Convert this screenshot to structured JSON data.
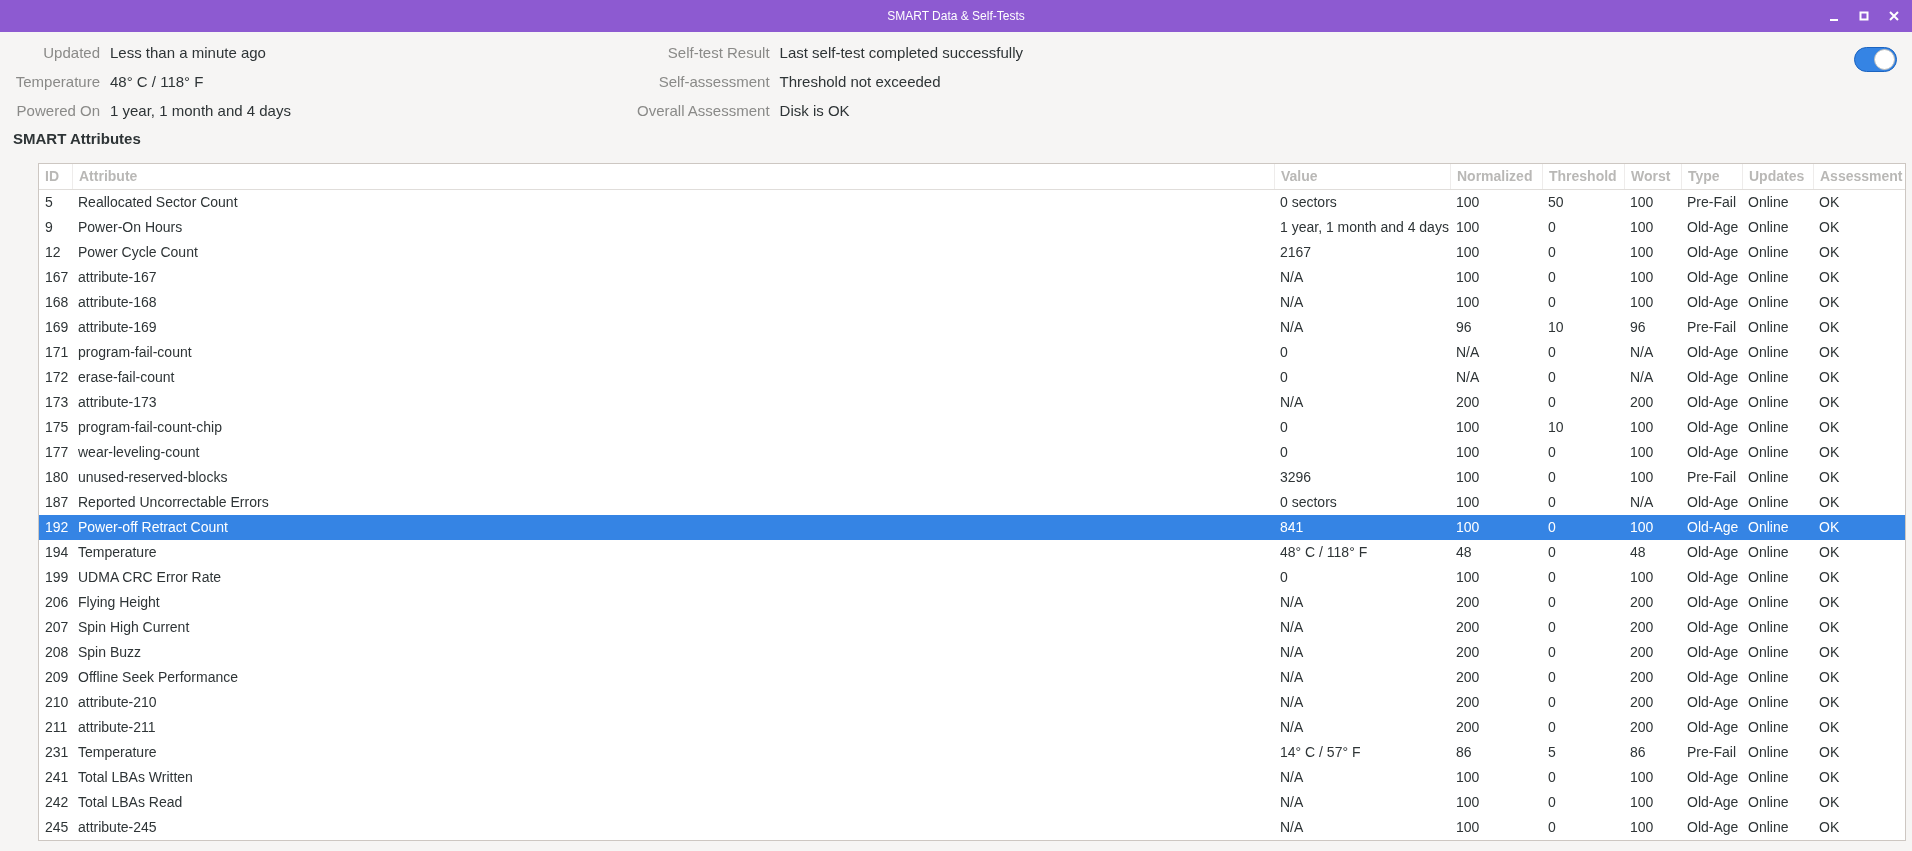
{
  "window": {
    "title": "SMART Data & Self-Tests"
  },
  "info_left": [
    {
      "label": "Updated",
      "value": "Less than a minute ago"
    },
    {
      "label": "Temperature",
      "value": "48° C / 118° F"
    },
    {
      "label": "Powered On",
      "value": "1 year, 1 month and 4 days"
    }
  ],
  "info_right": [
    {
      "label": "Self-test Result",
      "value": "Last self-test completed successfully"
    },
    {
      "label": "Self-assessment",
      "value": "Threshold not exceeded"
    },
    {
      "label": "Overall Assessment",
      "value": "Disk is OK"
    }
  ],
  "toggle": {
    "on": true
  },
  "section_title": "SMART Attributes",
  "table": {
    "columns": [
      "ID",
      "Attribute",
      "Value",
      "Normalized",
      "Threshold",
      "Worst",
      "Type",
      "Updates",
      "Assessment"
    ],
    "rows": [
      {
        "cells": [
          "5",
          "Reallocated Sector Count",
          "0 sectors",
          "100",
          "50",
          "100",
          "Pre-Fail",
          "Online",
          "OK"
        ],
        "selected": false
      },
      {
        "cells": [
          "9",
          "Power-On Hours",
          "1 year, 1 month and 4 days",
          "100",
          "0",
          "100",
          "Old-Age",
          "Online",
          "OK"
        ],
        "selected": false
      },
      {
        "cells": [
          "12",
          "Power Cycle Count",
          "2167",
          "100",
          "0",
          "100",
          "Old-Age",
          "Online",
          "OK"
        ],
        "selected": false
      },
      {
        "cells": [
          "167",
          "attribute-167",
          "N/A",
          "100",
          "0",
          "100",
          "Old-Age",
          "Online",
          "OK"
        ],
        "selected": false
      },
      {
        "cells": [
          "168",
          "attribute-168",
          "N/A",
          "100",
          "0",
          "100",
          "Old-Age",
          "Online",
          "OK"
        ],
        "selected": false
      },
      {
        "cells": [
          "169",
          "attribute-169",
          "N/A",
          "96",
          "10",
          "96",
          "Pre-Fail",
          "Online",
          "OK"
        ],
        "selected": false
      },
      {
        "cells": [
          "171",
          "program-fail-count",
          "0",
          "N/A",
          "0",
          "N/A",
          "Old-Age",
          "Online",
          "OK"
        ],
        "selected": false
      },
      {
        "cells": [
          "172",
          "erase-fail-count",
          "0",
          "N/A",
          "0",
          "N/A",
          "Old-Age",
          "Online",
          "OK"
        ],
        "selected": false
      },
      {
        "cells": [
          "173",
          "attribute-173",
          "N/A",
          "200",
          "0",
          "200",
          "Old-Age",
          "Online",
          "OK"
        ],
        "selected": false
      },
      {
        "cells": [
          "175",
          "program-fail-count-chip",
          "0",
          "100",
          "10",
          "100",
          "Old-Age",
          "Online",
          "OK"
        ],
        "selected": false
      },
      {
        "cells": [
          "177",
          "wear-leveling-count",
          "0",
          "100",
          "0",
          "100",
          "Old-Age",
          "Online",
          "OK"
        ],
        "selected": false
      },
      {
        "cells": [
          "180",
          "unused-reserved-blocks",
          "3296",
          "100",
          "0",
          "100",
          "Pre-Fail",
          "Online",
          "OK"
        ],
        "selected": false
      },
      {
        "cells": [
          "187",
          "Reported Uncorrectable Errors",
          "0 sectors",
          "100",
          "0",
          "N/A",
          "Old-Age",
          "Online",
          "OK"
        ],
        "selected": false
      },
      {
        "cells": [
          "192",
          "Power-off Retract Count",
          "841",
          "100",
          "0",
          "100",
          "Old-Age",
          "Online",
          "OK"
        ],
        "selected": true
      },
      {
        "cells": [
          "194",
          "Temperature",
          "48° C / 118° F",
          "48",
          "0",
          "48",
          "Old-Age",
          "Online",
          "OK"
        ],
        "selected": false
      },
      {
        "cells": [
          "199",
          "UDMA CRC Error Rate",
          "0",
          "100",
          "0",
          "100",
          "Old-Age",
          "Online",
          "OK"
        ],
        "selected": false
      },
      {
        "cells": [
          "206",
          "Flying Height",
          "N/A",
          "200",
          "0",
          "200",
          "Old-Age",
          "Online",
          "OK"
        ],
        "selected": false
      },
      {
        "cells": [
          "207",
          "Spin High Current",
          "N/A",
          "200",
          "0",
          "200",
          "Old-Age",
          "Online",
          "OK"
        ],
        "selected": false
      },
      {
        "cells": [
          "208",
          "Spin Buzz",
          "N/A",
          "200",
          "0",
          "200",
          "Old-Age",
          "Online",
          "OK"
        ],
        "selected": false
      },
      {
        "cells": [
          "209",
          "Offline Seek Performance",
          "N/A",
          "200",
          "0",
          "200",
          "Old-Age",
          "Online",
          "OK"
        ],
        "selected": false
      },
      {
        "cells": [
          "210",
          "attribute-210",
          "N/A",
          "200",
          "0",
          "200",
          "Old-Age",
          "Online",
          "OK"
        ],
        "selected": false
      },
      {
        "cells": [
          "211",
          "attribute-211",
          "N/A",
          "200",
          "0",
          "200",
          "Old-Age",
          "Online",
          "OK"
        ],
        "selected": false
      },
      {
        "cells": [
          "231",
          "Temperature",
          "14° C / 57° F",
          "86",
          "5",
          "86",
          "Pre-Fail",
          "Online",
          "OK"
        ],
        "selected": false
      },
      {
        "cells": [
          "241",
          "Total LBAs Written",
          "N/A",
          "100",
          "0",
          "100",
          "Old-Age",
          "Online",
          "OK"
        ],
        "selected": false
      },
      {
        "cells": [
          "242",
          "Total LBAs Read",
          "N/A",
          "100",
          "0",
          "100",
          "Old-Age",
          "Online",
          "OK"
        ],
        "selected": false
      },
      {
        "cells": [
          "245",
          "attribute-245",
          "N/A",
          "100",
          "0",
          "100",
          "Old-Age",
          "Online",
          "OK"
        ],
        "selected": false
      }
    ]
  }
}
